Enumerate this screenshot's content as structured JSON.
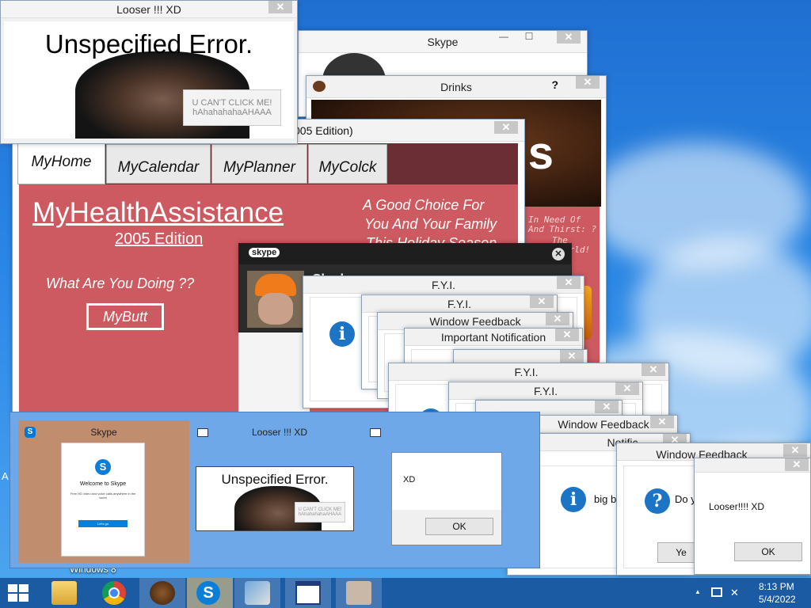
{
  "looser_top": {
    "title": "Looser !!! XD",
    "error_text": "Unspecified Error.",
    "cant_click_line1": "U CAN'T CLICK ME!",
    "cant_click_line2": "hAhahahahaAHAAA"
  },
  "skype_back": {
    "title": "Skype"
  },
  "drinks": {
    "title": "Drinks",
    "help_label": "?",
    "side_text_1": "In Need Of",
    "side_text_2": "And Thirst: ?",
    "side_text_3": "The",
    "side_text_4": "orld!"
  },
  "mha": {
    "title_fragment": "005 Edition)",
    "tabs": [
      "MyHome",
      "MyCalendar",
      "MyPlanner",
      "MyColck"
    ],
    "heading": "MyHealthAssistance",
    "subheading": "2005 Edition",
    "slogan_line1": "A Good Choice For",
    "slogan_line2": "You And Your Family",
    "slogan_line3": "This Holiday Season",
    "prompt": "What Are You Doing ??",
    "button_label": "MyButt"
  },
  "skype_call": {
    "logo": "skype",
    "caller_fragment": "Chad"
  },
  "dialogs": {
    "fyi_1": "F.Y.I.",
    "fyi_2": "F.Y.I.",
    "window_feedback_1": "Window Feedback",
    "important_notification": "Important Notification",
    "fyi_3": "F.Y.I.",
    "fyi_4": "F.Y.I.",
    "window_feedback_2": "Window Feedback",
    "notification_fragment": "Notific",
    "window_feedback_3": "Window Feedback",
    "big_text": "big bo",
    "do_text": "Do y",
    "yes_fragment": "Ye",
    "looser_msg": "Looser!!!! XD",
    "ok_label": "OK"
  },
  "preview": {
    "items": [
      {
        "title": "Skype",
        "welcome": "Welcome to Skype",
        "tagline": "Free HD video and voice calls anywhere in the world",
        "signin": "Let's go"
      },
      {
        "title": "Looser !!! XD",
        "error_text": "Unspecified Error.",
        "cant_line1": "U CAN'T CLICK ME!",
        "cant_line2": "hAhahahahaAHAAA"
      },
      {
        "title": "",
        "message": "XD",
        "ok_label": "OK"
      }
    ]
  },
  "desktop": {
    "icon_label": "Windows 8",
    "side_letter": "A"
  },
  "taskbar": {
    "time": "8:13 PM",
    "date": "5/4/2022",
    "tray_arrow": "▲",
    "accent": "#1a5ba4"
  }
}
